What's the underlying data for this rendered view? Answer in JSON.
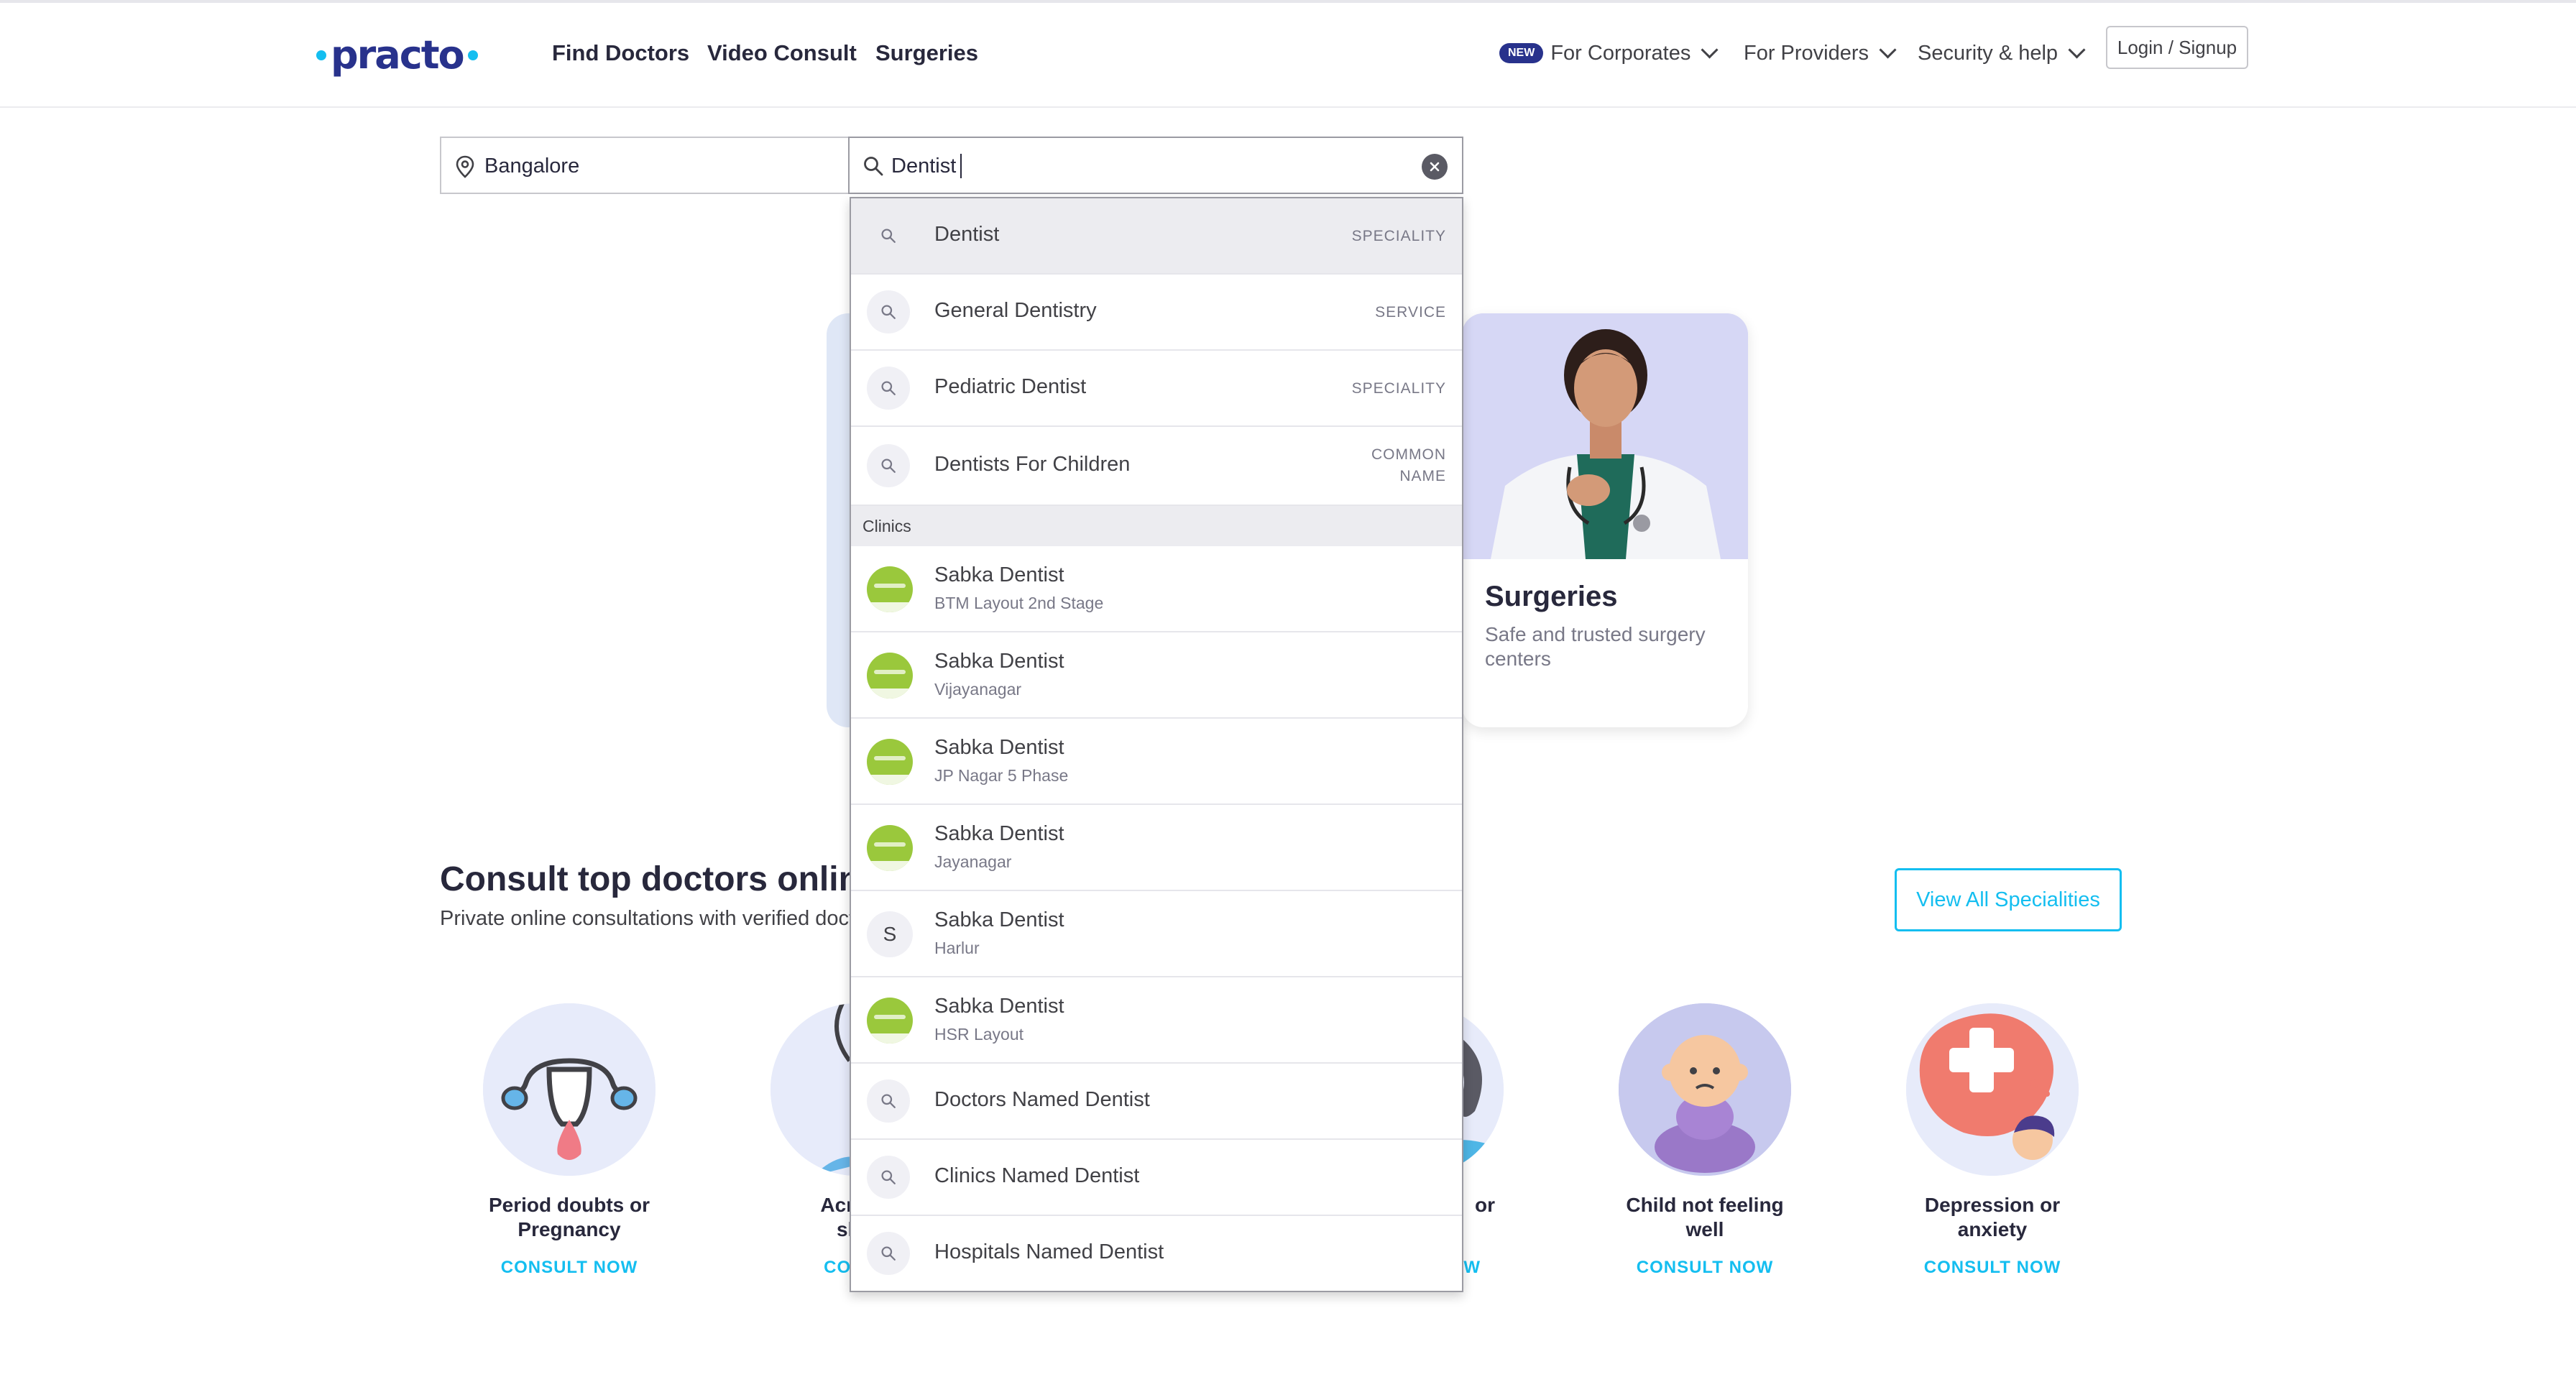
{
  "header": {
    "logo_text": "practo",
    "nav_main": [
      "Find Doctors",
      "Video Consult",
      "Surgeries"
    ],
    "new_badge": "NEW",
    "for_corporates": "For Corporates",
    "for_providers": "For Providers",
    "security_help": "Security & help",
    "login_signup": "Login / Signup"
  },
  "search": {
    "location_value": "Bangalore",
    "query_value": "Dentist"
  },
  "suggestions": {
    "top": [
      {
        "label": "Dentist",
        "type": "SPECIALITY"
      },
      {
        "label": "General Dentistry",
        "type": "SERVICE"
      },
      {
        "label": "Pediatric Dentist",
        "type": "SPECIALITY"
      },
      {
        "label": "Dentists For Children",
        "type_line1": "COMMON",
        "type_line2": "NAME"
      }
    ],
    "clinics_header": "Clinics",
    "clinics": [
      {
        "name": "Sabka Dentist",
        "area": "BTM Layout 2nd Stage",
        "avatar": "logo"
      },
      {
        "name": "Sabka Dentist",
        "area": "Vijayanagar",
        "avatar": "logo"
      },
      {
        "name": "Sabka Dentist",
        "area": "JP Nagar 5 Phase",
        "avatar": "logo"
      },
      {
        "name": "Sabka Dentist",
        "area": "Jayanagar",
        "avatar": "logo"
      },
      {
        "name": "Sabka Dentist",
        "area": "Harlur",
        "avatar": "S"
      },
      {
        "name": "Sabka Dentist",
        "area": "HSR Layout",
        "avatar": "logo"
      }
    ],
    "bottom": [
      {
        "label": "Doctors Named Dentist"
      },
      {
        "label": "Clinics Named Dentist"
      },
      {
        "label": "Hospitals Named Dentist"
      }
    ]
  },
  "surgeries_card": {
    "title": "Surgeries",
    "subtitle": "Safe and trusted surgery centers"
  },
  "consult": {
    "title": "Consult top doctors online",
    "subtitle": "Private online consultations with verified docto",
    "view_all": "View All Specialities",
    "items": [
      {
        "name_line1": "Period doubts or",
        "name_line2": "Pregnancy",
        "cta": "CONSULT NOW"
      },
      {
        "name_line1": "Acne, p",
        "name_line2": "skin",
        "cta": "CONSU"
      },
      {
        "name_line1": "or",
        "name_line2": "",
        "cta": "W"
      },
      {
        "name_line1": "Child not feeling",
        "name_line2": "well",
        "cta": "CONSULT NOW"
      },
      {
        "name_line1": "Depression or",
        "name_line2": "anxiety",
        "cta": "CONSULT NOW"
      }
    ]
  },
  "colors": {
    "brand_navy": "#28328c",
    "brand_cyan": "#14bef0",
    "text_dark": "#28283c"
  },
  "icons": {
    "location": "map-pin-icon",
    "search": "search-icon",
    "clear": "close-circle-icon",
    "chevron": "chevron-down-icon"
  }
}
